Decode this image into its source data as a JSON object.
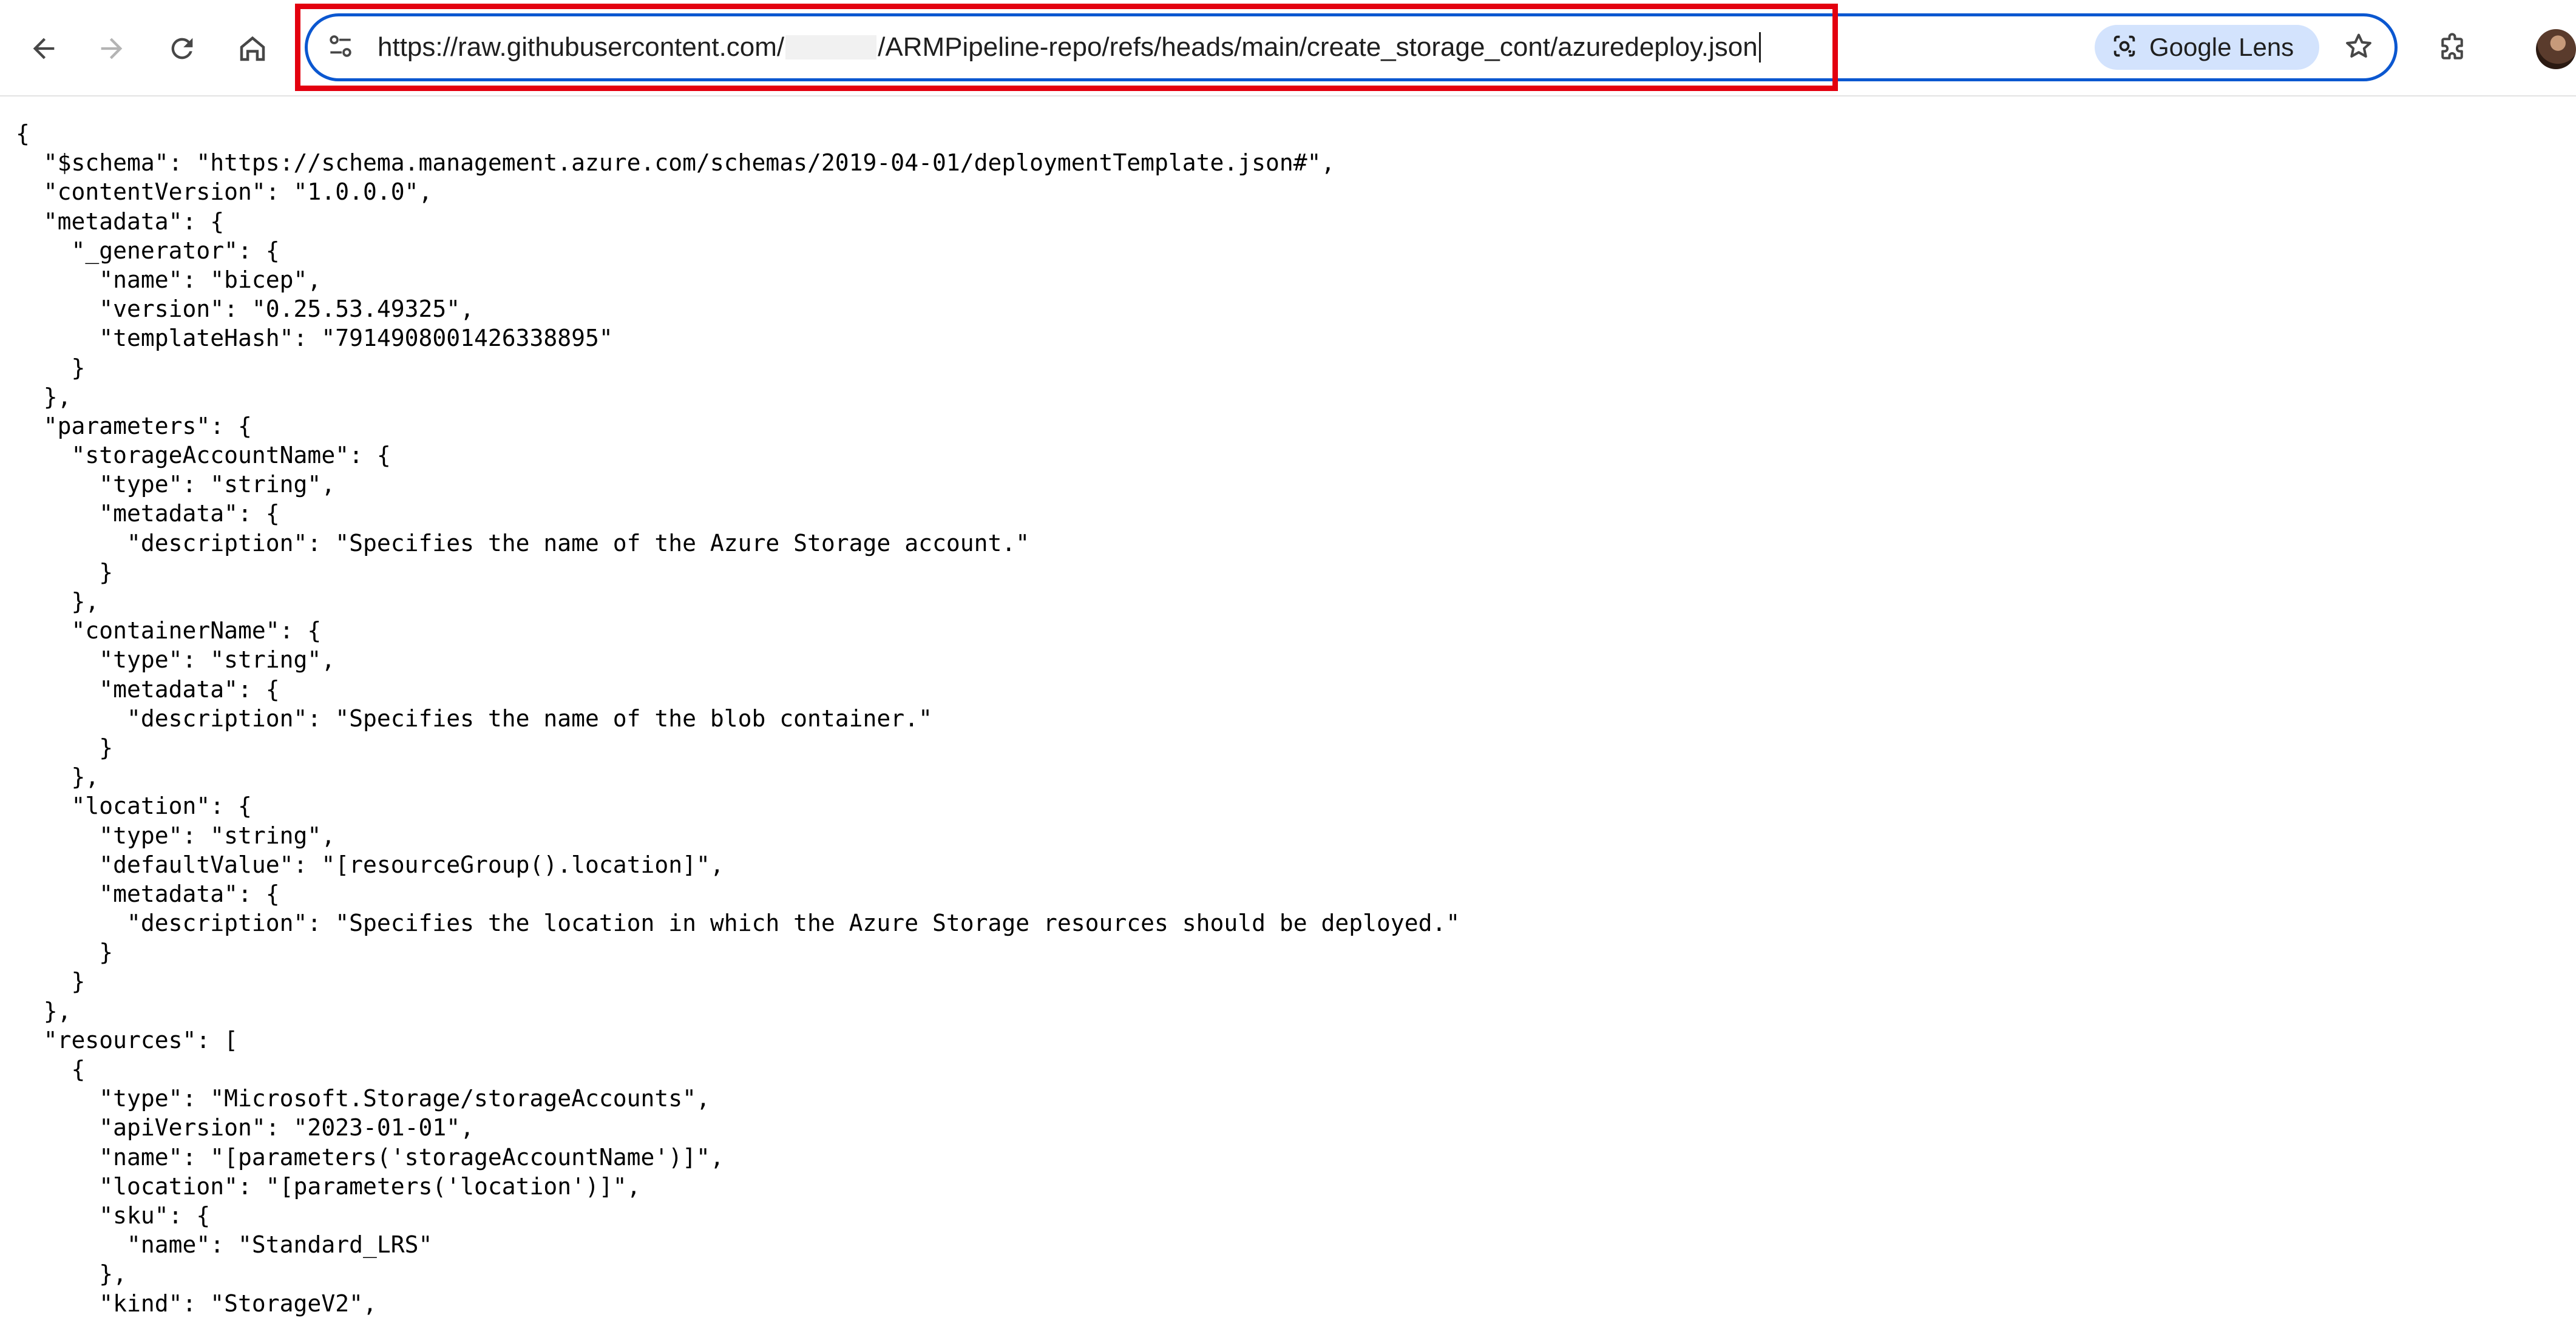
{
  "browser": {
    "toolbar": {
      "back_icon": "arrow-left-icon",
      "forward_icon": "arrow-right-icon",
      "reload_icon": "reload-icon",
      "home_icon": "home-icon",
      "extensions_icon": "puzzle-icon"
    },
    "omnibox": {
      "site_info_icon": "tune-icon",
      "url_prefix": "https://raw.githubusercontent.com/",
      "url_suffix": "/ARMPipeline-repo/refs/heads/main/create_storage_cont/azuredeploy.json",
      "lens_label": "Google Lens",
      "lens_icon": "google-lens-icon",
      "bookmark_icon": "star-icon"
    },
    "accent_color": "#0b57d0",
    "highlight_color": "#e3000f",
    "lens_chip_color": "#d3e3fd"
  },
  "json_lines": [
    "{",
    "  \"$schema\": \"https://schema.management.azure.com/schemas/2019-04-01/deploymentTemplate.json#\",",
    "  \"contentVersion\": \"1.0.0.0\",",
    "  \"metadata\": {",
    "    \"_generator\": {",
    "      \"name\": \"bicep\",",
    "      \"version\": \"0.25.53.49325\",",
    "      \"templateHash\": \"7914908001426338895\"",
    "    }",
    "  },",
    "  \"parameters\": {",
    "    \"storageAccountName\": {",
    "      \"type\": \"string\",",
    "      \"metadata\": {",
    "        \"description\": \"Specifies the name of the Azure Storage account.\"",
    "      }",
    "    },",
    "    \"containerName\": {",
    "      \"type\": \"string\",",
    "      \"metadata\": {",
    "        \"description\": \"Specifies the name of the blob container.\"",
    "      }",
    "    },",
    "    \"location\": {",
    "      \"type\": \"string\",",
    "      \"defaultValue\": \"[resourceGroup().location]\",",
    "      \"metadata\": {",
    "        \"description\": \"Specifies the location in which the Azure Storage resources should be deployed.\"",
    "      }",
    "    }",
    "  },",
    "  \"resources\": [",
    "    {",
    "      \"type\": \"Microsoft.Storage/storageAccounts\",",
    "      \"apiVersion\": \"2023-01-01\",",
    "      \"name\": \"[parameters('storageAccountName')]\",",
    "      \"location\": \"[parameters('location')]\",",
    "      \"sku\": {",
    "        \"name\": \"Standard_LRS\"",
    "      },",
    "      \"kind\": \"StorageV2\","
  ]
}
